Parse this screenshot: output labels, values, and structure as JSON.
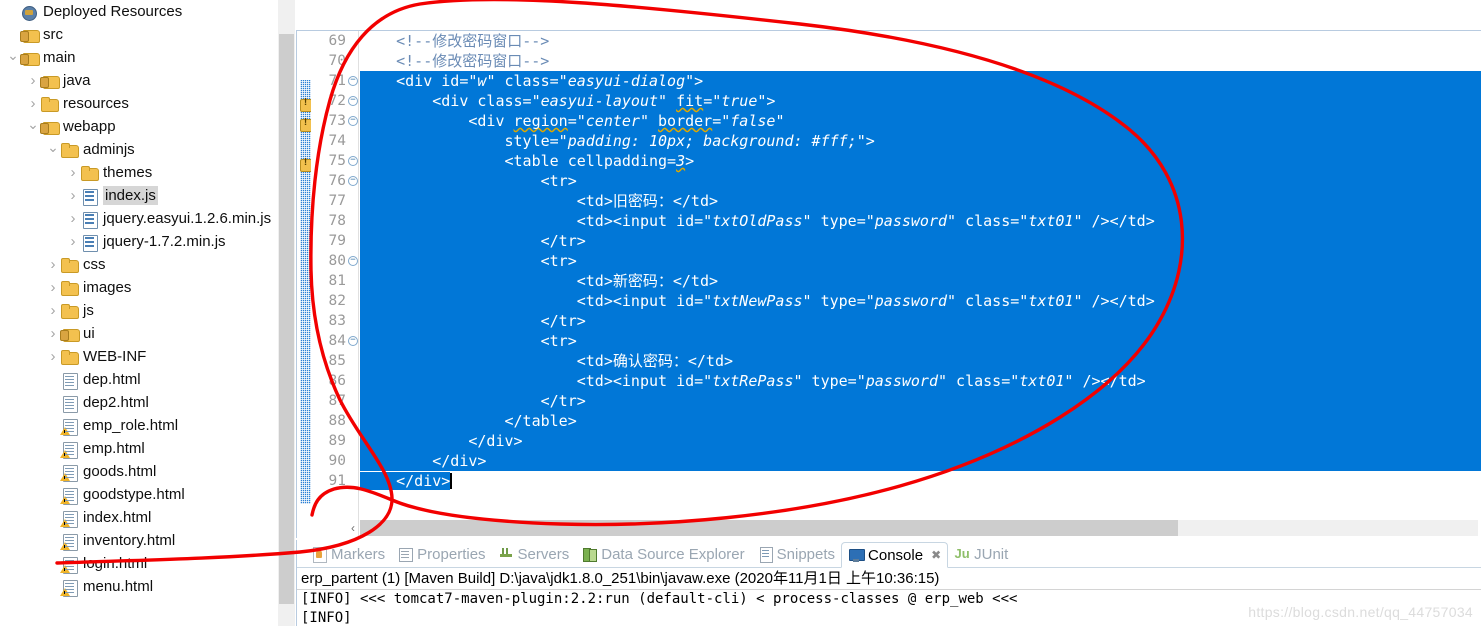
{
  "explorer": {
    "name": "project-explorer",
    "items": [
      {
        "label": "Deployed Resources",
        "indent": 0,
        "twisty": "none",
        "icon": "deployed-icon",
        "kind": "deployed",
        "selected": false
      },
      {
        "label": "src",
        "indent": 0,
        "twisty": "none",
        "icon": "source-folder-icon",
        "kind": "srcfolder",
        "selected": false
      },
      {
        "label": "main",
        "indent": 0,
        "twisty": "open",
        "icon": "source-folder-icon",
        "kind": "srcfolder",
        "selected": false
      },
      {
        "label": "java",
        "indent": 1,
        "twisty": "closed",
        "icon": "source-folder-icon",
        "kind": "srcfolder",
        "selected": false
      },
      {
        "label": "resources",
        "indent": 1,
        "twisty": "closed",
        "icon": "folder-icon",
        "kind": "folder",
        "selected": false
      },
      {
        "label": "webapp",
        "indent": 1,
        "twisty": "open",
        "icon": "source-folder-icon",
        "kind": "srcfolder",
        "selected": false
      },
      {
        "label": "adminjs",
        "indent": 2,
        "twisty": "open",
        "icon": "folder-icon",
        "kind": "folder",
        "selected": false
      },
      {
        "label": "themes",
        "indent": 3,
        "twisty": "closed",
        "icon": "folder-icon",
        "kind": "folder",
        "selected": false
      },
      {
        "label": "index.js",
        "indent": 3,
        "twisty": "closed",
        "icon": "js-file-icon",
        "kind": "jsfile",
        "selected": true
      },
      {
        "label": "jquery.easyui.1.2.6.min.js",
        "indent": 3,
        "twisty": "closed",
        "icon": "js-file-icon",
        "kind": "jsfile",
        "selected": false
      },
      {
        "label": "jquery-1.7.2.min.js",
        "indent": 3,
        "twisty": "closed",
        "icon": "js-file-icon",
        "kind": "jsfile",
        "selected": false
      },
      {
        "label": "css",
        "indent": 2,
        "twisty": "closed",
        "icon": "folder-icon",
        "kind": "folder",
        "selected": false
      },
      {
        "label": "images",
        "indent": 2,
        "twisty": "closed",
        "icon": "folder-icon",
        "kind": "folder",
        "selected": false
      },
      {
        "label": "js",
        "indent": 2,
        "twisty": "closed",
        "icon": "folder-icon",
        "kind": "folder",
        "selected": false
      },
      {
        "label": "ui",
        "indent": 2,
        "twisty": "closed",
        "icon": "source-folder-icon",
        "kind": "srcfolder",
        "selected": false
      },
      {
        "label": "WEB-INF",
        "indent": 2,
        "twisty": "closed",
        "icon": "folder-icon",
        "kind": "folder",
        "selected": false
      },
      {
        "label": "dep.html",
        "indent": 2,
        "twisty": "none",
        "icon": "html-file-icon",
        "kind": "file",
        "selected": false
      },
      {
        "label": "dep2.html",
        "indent": 2,
        "twisty": "none",
        "icon": "html-file-icon",
        "kind": "file",
        "selected": false
      },
      {
        "label": "emp_role.html",
        "indent": 2,
        "twisty": "none",
        "icon": "html-file-warning-icon",
        "kind": "file-warn",
        "selected": false
      },
      {
        "label": "emp.html",
        "indent": 2,
        "twisty": "none",
        "icon": "html-file-warning-icon",
        "kind": "file-warn",
        "selected": false
      },
      {
        "label": "goods.html",
        "indent": 2,
        "twisty": "none",
        "icon": "html-file-warning-icon",
        "kind": "file-warn",
        "selected": false
      },
      {
        "label": "goodstype.html",
        "indent": 2,
        "twisty": "none",
        "icon": "html-file-warning-icon",
        "kind": "file-warn",
        "selected": false
      },
      {
        "label": "index.html",
        "indent": 2,
        "twisty": "none",
        "icon": "html-file-warning-icon",
        "kind": "file-warn",
        "selected": false
      },
      {
        "label": "inventory.html",
        "indent": 2,
        "twisty": "none",
        "icon": "html-file-warning-icon",
        "kind": "file-warn",
        "selected": false
      },
      {
        "label": "login.html",
        "indent": 2,
        "twisty": "none",
        "icon": "html-file-warning-icon",
        "kind": "file-warn",
        "selected": false
      },
      {
        "label": "menu.html",
        "indent": 2,
        "twisty": "none",
        "icon": "html-file-warning-icon",
        "kind": "file-warn",
        "selected": false
      }
    ]
  },
  "editor": {
    "first_line": 69,
    "selection_color": "#0177d7",
    "comment_color": "#6a8bb5",
    "lines": [
      {
        "n": 69,
        "fold": false,
        "warn": false,
        "text": "    <!--修改密码窗口-->",
        "style": "comment",
        "sel": "none"
      },
      {
        "n": 70,
        "fold": false,
        "warn": false,
        "text": "    <!--修改密码窗口-->",
        "style": "comment",
        "sel": "none"
      },
      {
        "n": 71,
        "fold": true,
        "warn": false,
        "text": "    <div id=\"w\" class=\"easyui-dialog\">",
        "style": "code",
        "sel": "full"
      },
      {
        "n": 72,
        "fold": true,
        "warn": true,
        "text": "        <div class=\"easyui-layout\" fit=\"true\">",
        "style": "code",
        "sel": "full"
      },
      {
        "n": 73,
        "fold": true,
        "warn": true,
        "text": "            <div region=\"center\" border=\"false\"",
        "style": "code",
        "sel": "full"
      },
      {
        "n": 74,
        "fold": false,
        "warn": false,
        "text": "                style=\"padding: 10px; background: #fff;\">",
        "style": "code",
        "sel": "full"
      },
      {
        "n": 75,
        "fold": true,
        "warn": true,
        "text": "                <table cellpadding=3>",
        "style": "code",
        "sel": "full"
      },
      {
        "n": 76,
        "fold": true,
        "warn": false,
        "text": "                    <tr>",
        "style": "code",
        "sel": "full"
      },
      {
        "n": 77,
        "fold": false,
        "warn": false,
        "text": "                        <td>旧密码：</td>",
        "style": "code",
        "sel": "full"
      },
      {
        "n": 78,
        "fold": false,
        "warn": false,
        "text": "                        <td><input id=\"txtOldPass\" type=\"password\" class=\"txt01\" /></td>",
        "style": "code",
        "sel": "full"
      },
      {
        "n": 79,
        "fold": false,
        "warn": false,
        "text": "                    </tr>",
        "style": "code",
        "sel": "full"
      },
      {
        "n": 80,
        "fold": true,
        "warn": false,
        "text": "                    <tr>",
        "style": "code",
        "sel": "full"
      },
      {
        "n": 81,
        "fold": false,
        "warn": false,
        "text": "                        <td>新密码：</td>",
        "style": "code",
        "sel": "full"
      },
      {
        "n": 82,
        "fold": false,
        "warn": false,
        "text": "                        <td><input id=\"txtNewPass\" type=\"password\" class=\"txt01\" /></td>",
        "style": "code",
        "sel": "full"
      },
      {
        "n": 83,
        "fold": false,
        "warn": false,
        "text": "                    </tr>",
        "style": "code",
        "sel": "full"
      },
      {
        "n": 84,
        "fold": true,
        "warn": false,
        "text": "                    <tr>",
        "style": "code",
        "sel": "full"
      },
      {
        "n": 85,
        "fold": false,
        "warn": false,
        "text": "                        <td>确认密码：</td>",
        "style": "code",
        "sel": "full"
      },
      {
        "n": 86,
        "fold": false,
        "warn": false,
        "text": "                        <td><input id=\"txtRePass\" type=\"password\" class=\"txt01\" /></td>",
        "style": "code",
        "sel": "full"
      },
      {
        "n": 87,
        "fold": false,
        "warn": false,
        "text": "                    </tr>",
        "style": "code",
        "sel": "full"
      },
      {
        "n": 88,
        "fold": false,
        "warn": false,
        "text": "                </table>",
        "style": "code",
        "sel": "full"
      },
      {
        "n": 89,
        "fold": false,
        "warn": false,
        "text": "            </div>",
        "style": "code",
        "sel": "full"
      },
      {
        "n": 90,
        "fold": false,
        "warn": false,
        "text": "        </div>",
        "style": "code",
        "sel": "full"
      },
      {
        "n": 91,
        "fold": false,
        "warn": false,
        "text": "    </div>",
        "style": "code",
        "sel": "partial-caret"
      }
    ]
  },
  "bottom": {
    "tabs": [
      {
        "label": "Markers",
        "icon": "markers-icon",
        "active": false,
        "closable": false
      },
      {
        "label": "Properties",
        "icon": "properties-icon",
        "active": false,
        "closable": false
      },
      {
        "label": "Servers",
        "icon": "servers-icon",
        "active": false,
        "closable": false
      },
      {
        "label": "Data Source Explorer",
        "icon": "data-source-explorer-icon",
        "active": false,
        "closable": false
      },
      {
        "label": "Snippets",
        "icon": "snippets-icon",
        "active": false,
        "closable": false
      },
      {
        "label": "Console",
        "icon": "console-icon",
        "active": true,
        "closable": true
      },
      {
        "label": "JUnit",
        "icon": "junit-icon",
        "active": false,
        "closable": false
      }
    ],
    "close_glyph": "✖",
    "junit_glyph": "Ju",
    "console_title": "erp_partent (1) [Maven Build] D:\\java\\jdk1.8.0_251\\bin\\javaw.exe (2020年11月1日 上午10:36:15)",
    "console_lines": [
      "[INFO] <<< tomcat7-maven-plugin:2.2:run (default-cli) < process-classes @ erp_web <<<",
      "[INFO]"
    ]
  },
  "watermark": {
    "text": "https://blog.csdn.net/qq_44757034"
  },
  "annotation": {
    "name": "red-hand-drawn-loop",
    "color": "#f20000"
  }
}
